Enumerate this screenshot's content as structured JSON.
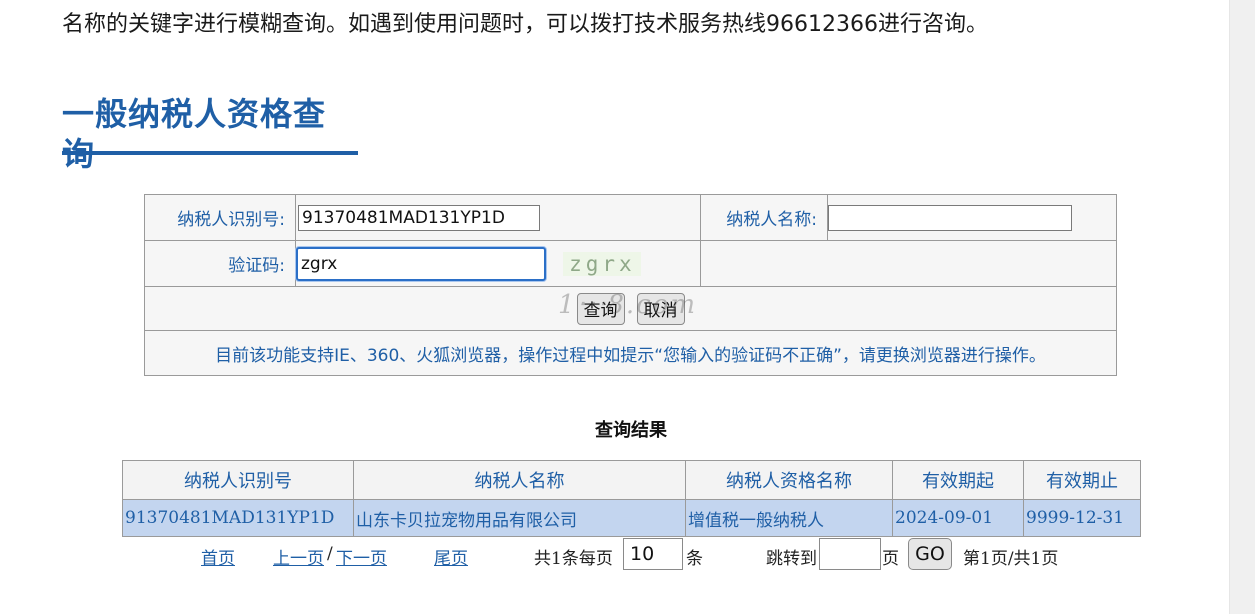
{
  "intro_text": "名称的关键字进行模糊查询。如遇到使用问题时，可以拨打技术服务热线96612366进行咨询。",
  "heading": "一般纳税人资格查询",
  "form": {
    "taxpayer_id_label": "纳税人识别号:",
    "taxpayer_id_value": "91370481MAD131YP1D",
    "taxpayer_name_label": "纳税人名称:",
    "taxpayer_name_value": "",
    "captcha_label": "验证码:",
    "captcha_value": "zgrx",
    "captcha_image_text": "zgrx",
    "query_button": "查询",
    "cancel_button": "取消",
    "browser_note": "目前该功能支持IE、360、火狐浏览器，操作过程中如提示“您输入的验证码不正确”，请更换浏览器进行操作。"
  },
  "results": {
    "caption": "查询结果",
    "columns": [
      "纳税人识别号",
      "纳税人名称",
      "纳税人资格名称",
      "有效期起",
      "有效期止"
    ],
    "rows": [
      [
        "91370481MAD131YP1D",
        "山东卡贝拉宠物用品有限公司",
        "增值税一般纳税人",
        "2024-09-01",
        "9999-12-31"
      ]
    ]
  },
  "pager": {
    "first": "首页",
    "prev": "上一页",
    "sep": "/",
    "next": "下一页",
    "last": "尾页",
    "count_text": "共1条每页",
    "page_size": "10",
    "unit": "条",
    "jump_label": "跳转到",
    "jump_value": "",
    "page_unit": "页",
    "go_button": "GO",
    "page_status": "第1页/共1页"
  },
  "colors": {
    "accent": "#1f5fa6",
    "row_highlight": "#c3d5ef"
  }
}
